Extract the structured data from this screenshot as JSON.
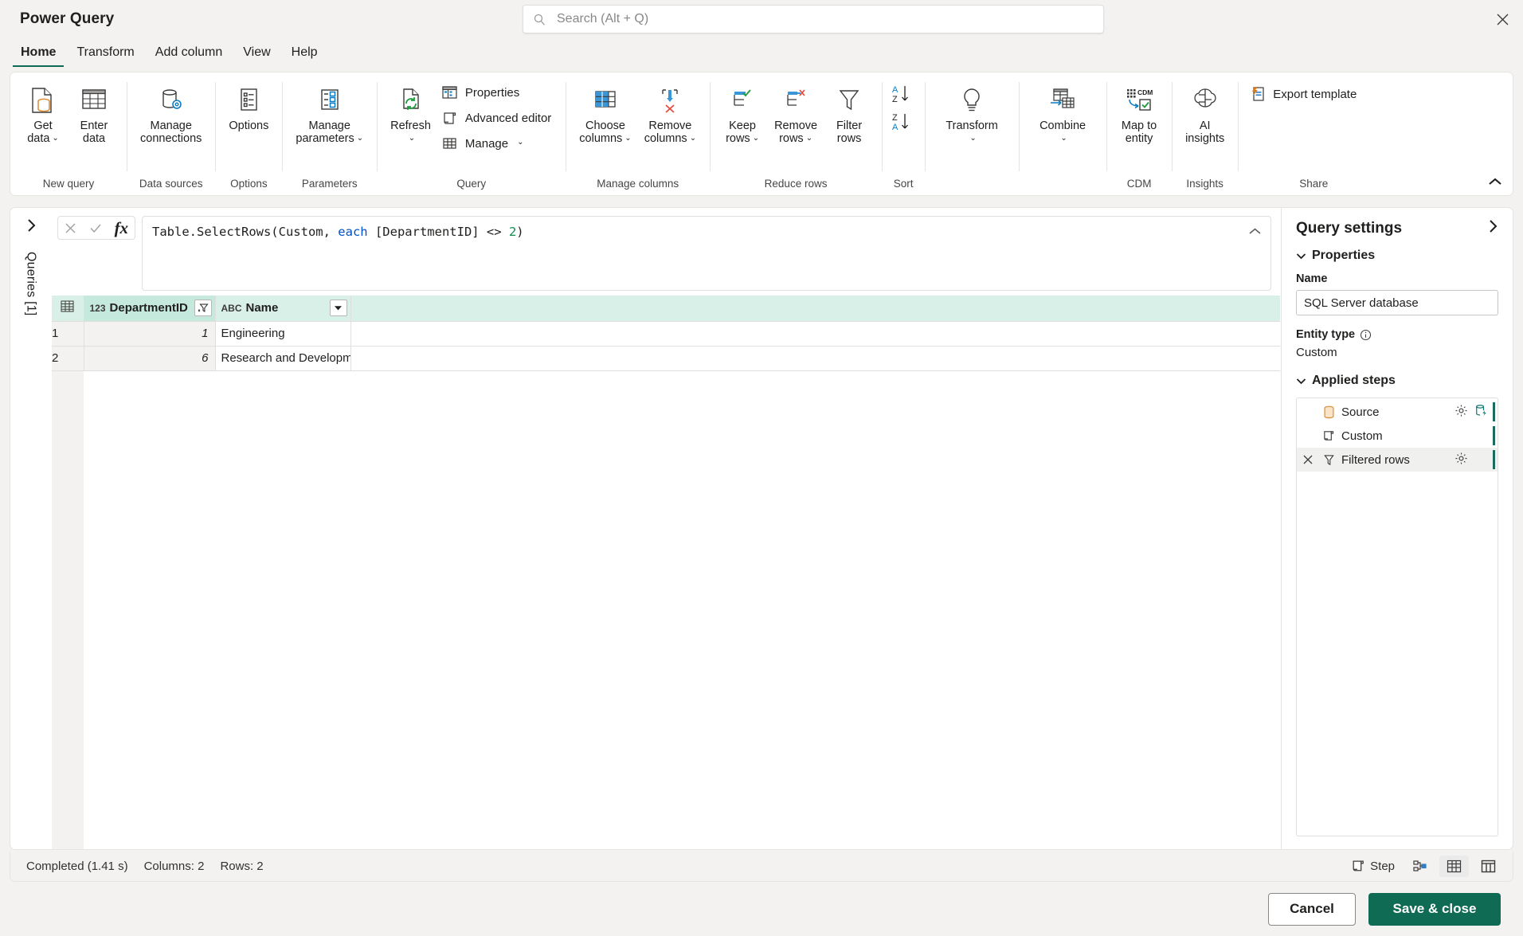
{
  "app": {
    "title": "Power Query",
    "close_label": "✕"
  },
  "search": {
    "placeholder": "Search (Alt + Q)",
    "value": "",
    "icon": "search-icon"
  },
  "tabs": [
    {
      "label": "Home",
      "active": true
    },
    {
      "label": "Transform",
      "active": false
    },
    {
      "label": "Add column",
      "active": false
    },
    {
      "label": "View",
      "active": false
    },
    {
      "label": "Help",
      "active": false
    }
  ],
  "ribbon": {
    "groups": [
      {
        "name": "New query",
        "label": "New query",
        "buttons": [
          {
            "name": "get-data-button",
            "label": "Get\ndata",
            "icon": "get-data-icon",
            "caret": true
          },
          {
            "name": "enter-data-button",
            "label": "Enter\ndata",
            "icon": "table-icon",
            "caret": false
          }
        ]
      },
      {
        "name": "Data sources",
        "label": "Data sources",
        "buttons": [
          {
            "name": "manage-connections-button",
            "label": "Manage\nconnections",
            "icon": "database-gear-icon",
            "caret": false
          }
        ]
      },
      {
        "name": "Options",
        "label": "Options",
        "buttons": [
          {
            "name": "options-button",
            "label": "Options",
            "icon": "options-list-icon",
            "caret": false
          }
        ]
      },
      {
        "name": "Parameters",
        "label": "Parameters",
        "buttons": [
          {
            "name": "manage-parameters-button",
            "label": "Manage\nparameters",
            "icon": "parameters-icon",
            "caret": true
          }
        ]
      },
      {
        "name": "Query",
        "label": "Query",
        "buttons": [
          {
            "name": "refresh-button",
            "label": "Refresh",
            "icon": "refresh-icon",
            "caret": true
          }
        ],
        "small_buttons": [
          {
            "name": "properties-button",
            "label": "Properties",
            "icon": "properties-icon",
            "caret": false
          },
          {
            "name": "advanced-editor-button",
            "label": "Advanced editor",
            "icon": "advanced-editor-icon",
            "caret": false
          },
          {
            "name": "manage-button",
            "label": "Manage",
            "icon": "manage-table-icon",
            "caret": true
          }
        ]
      },
      {
        "name": "Manage columns",
        "label": "Manage columns",
        "buttons": [
          {
            "name": "choose-columns-button",
            "label": "Choose\ncolumns",
            "icon": "choose-columns-icon",
            "caret": true
          },
          {
            "name": "remove-columns-button",
            "label": "Remove\ncolumns",
            "icon": "remove-columns-icon",
            "caret": true
          }
        ]
      },
      {
        "name": "Reduce rows",
        "label": "Reduce rows",
        "buttons": [
          {
            "name": "keep-rows-button",
            "label": "Keep\nrows",
            "icon": "keep-rows-icon",
            "caret": true
          },
          {
            "name": "remove-rows-button",
            "label": "Remove\nrows",
            "icon": "remove-rows-icon",
            "caret": true
          },
          {
            "name": "filter-rows-button",
            "label": "Filter\nrows",
            "icon": "funnel-icon",
            "caret": false
          }
        ]
      },
      {
        "name": "Sort",
        "label": "Sort",
        "buttons": [
          {
            "name": "sort-buttons",
            "label": "",
            "icon": "sort-az-za-icon",
            "caret": false
          }
        ]
      },
      {
        "name": "Transform group",
        "label": "",
        "buttons": [
          {
            "name": "transform-button",
            "label": "Transform",
            "icon": "lightbulb-icon",
            "caret": true
          }
        ]
      },
      {
        "name": "Combine group",
        "label": "",
        "buttons": [
          {
            "name": "combine-button",
            "label": "Combine",
            "icon": "combine-icon",
            "caret": true
          }
        ]
      },
      {
        "name": "CDM",
        "label": "CDM",
        "buttons": [
          {
            "name": "map-to-entity-button",
            "label": "Map to\nentity",
            "icon": "cdm-map-icon",
            "caret": false
          }
        ]
      },
      {
        "name": "Insights",
        "label": "Insights",
        "buttons": [
          {
            "name": "ai-insights-button",
            "label": "AI\ninsights",
            "icon": "brain-icon",
            "caret": false
          }
        ]
      },
      {
        "name": "Share",
        "label": "Share",
        "small_buttons": [
          {
            "name": "export-template-button",
            "label": "Export template",
            "icon": "export-template-icon",
            "caret": false
          }
        ]
      }
    ],
    "collapse_icon": "chevron-up-icon"
  },
  "queries_rail": {
    "label": "Queries [1]",
    "expand_icon": "chevron-right-icon"
  },
  "formula_bar": {
    "cancel_icon": "cancel-x-icon",
    "commit_icon": "check-icon",
    "fx_label": "fx",
    "formula_parts": [
      {
        "text": "Table.SelectRows(Custom, ",
        "kind": "plain"
      },
      {
        "text": "each",
        "kind": "keyword"
      },
      {
        "text": " [DepartmentID] <> ",
        "kind": "plain"
      },
      {
        "text": "2",
        "kind": "number"
      },
      {
        "text": ")",
        "kind": "plain"
      }
    ],
    "formula_text": "Table.SelectRows(Custom, each [DepartmentID] <> 2)",
    "collapse_icon": "chevron-up-icon"
  },
  "grid": {
    "select_all_icon": "select-all-table-icon",
    "columns": [
      {
        "name": "DepartmentID",
        "type_icon": "123",
        "type": "number",
        "filtered": true,
        "filter_icon": "filter-active-icon"
      },
      {
        "name": "Name",
        "type_icon": "ABC",
        "type": "text",
        "filtered": false,
        "filter_icon": "chevron-down-icon"
      }
    ],
    "rows": [
      {
        "num": "1",
        "DepartmentID": "1",
        "Name": "Engineering"
      },
      {
        "num": "2",
        "DepartmentID": "6",
        "Name": "Research and Developm..."
      }
    ]
  },
  "query_settings": {
    "title": "Query settings",
    "collapse_icon": "chevron-right-icon",
    "properties": {
      "section_label": "Properties",
      "name_label": "Name",
      "name_value": "SQL Server database",
      "entity_type_label": "Entity type",
      "entity_type_info_icon": "info-icon",
      "entity_type_value": "Custom"
    },
    "applied_steps": {
      "section_label": "Applied steps",
      "steps": [
        {
          "label": "Source",
          "icon": "database-icon",
          "has_delete": false,
          "has_gear": true,
          "has_extra": true,
          "extra_icon": "data-source-settings-icon",
          "selected": false
        },
        {
          "label": "Custom",
          "icon": "script-icon",
          "has_delete": false,
          "has_gear": false,
          "has_extra": false,
          "selected": false
        },
        {
          "label": "Filtered rows",
          "icon": "funnel-icon",
          "has_delete": true,
          "has_gear": true,
          "has_extra": false,
          "selected": true
        }
      ]
    }
  },
  "status_bar": {
    "completed": "Completed (1.41 s)",
    "columns": "Columns: 2",
    "rows": "Rows: 2",
    "step_label": "Step",
    "step_icon": "script-icon",
    "diagram_icon": "diagram-view-icon",
    "data_view_icon": "data-view-icon",
    "schema_view_icon": "schema-view-icon"
  },
  "footer": {
    "cancel_label": "Cancel",
    "save_label": "Save & close"
  },
  "colors": {
    "accent": "#0f6b54",
    "header_highlight": "#c6e9dd",
    "header_bg": "#d9f0e8",
    "step_bar": "#1b6b60",
    "keyword": "#0050c8",
    "number": "#0f8a4f",
    "orange": "#d98c36"
  }
}
